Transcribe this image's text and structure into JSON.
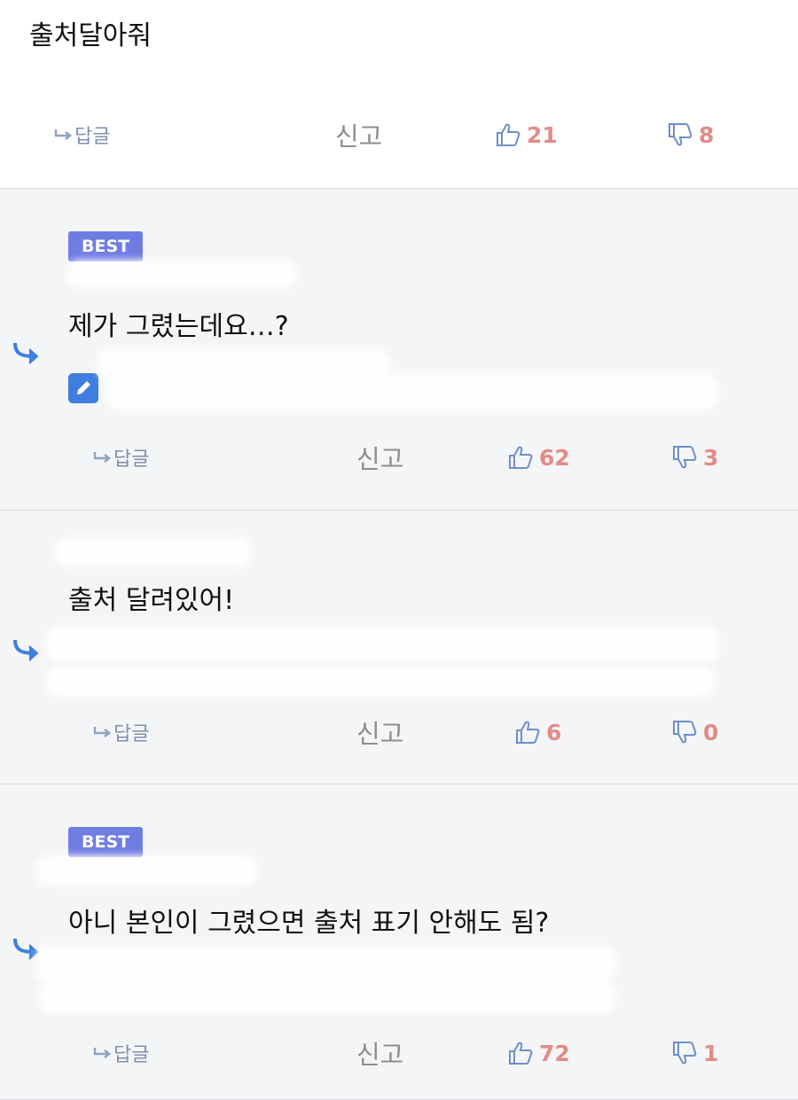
{
  "comments": [
    {
      "best": null,
      "text": "출처달아줘",
      "reply_label": "답글",
      "report_label": "신고",
      "likes": "21",
      "dislikes": "8"
    },
    {
      "best": "BEST",
      "text": "제가 그렸는데요…?",
      "reply_label": "답글",
      "report_label": "신고",
      "likes": "62",
      "dislikes": "3"
    },
    {
      "best": null,
      "text": "출처 달려있어!",
      "reply_label": "답글",
      "report_label": "신고",
      "likes": "6",
      "dislikes": "0"
    },
    {
      "best": "BEST",
      "text": "아니 본인이 그렸으면 출처 표기 안해도 됨?",
      "reply_label": "답글",
      "report_label": "신고",
      "likes": "72",
      "dislikes": "1"
    }
  ],
  "colors": {
    "best_badge": "#6f7de3",
    "count": "#e38b86",
    "reply_arrow": "#3f7ee0",
    "muted": "#8e8e8e"
  },
  "icons": [
    "reply-arrow-icon",
    "thumbs-up-icon",
    "thumbs-down-icon",
    "edit-pencil-icon"
  ]
}
